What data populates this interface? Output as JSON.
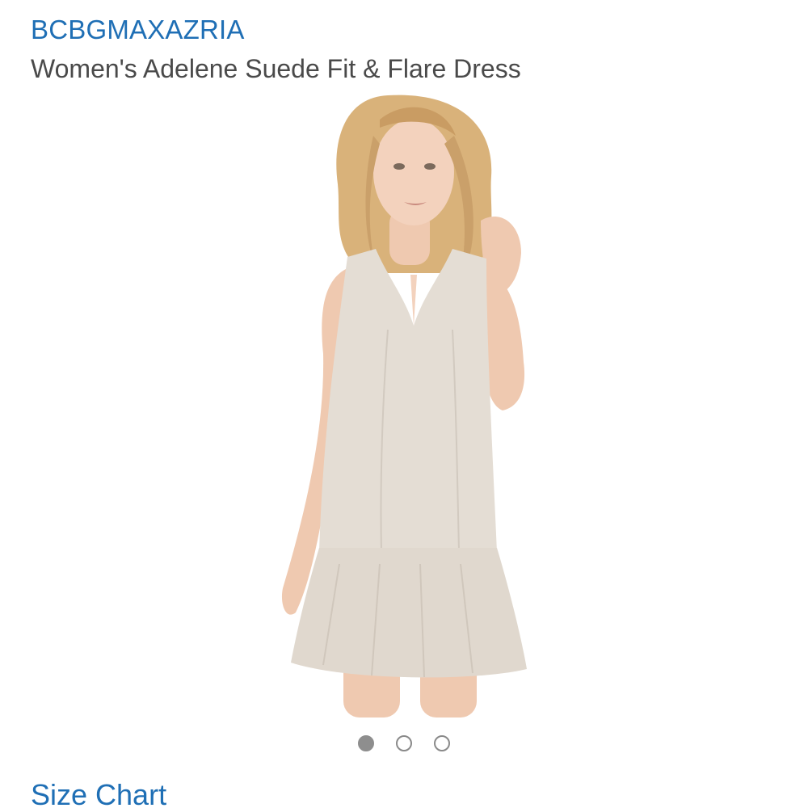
{
  "product": {
    "brand": "BCBGMAXAZRIA",
    "title": "Women's Adelene Suede Fit & Flare Dress",
    "image_alt": "Model wearing light beige sleeveless suede fit and flare dress"
  },
  "carousel": {
    "total": 3,
    "active_index": 0
  },
  "links": {
    "size_chart": "Size Chart"
  },
  "colors": {
    "link": "#1f6fb5",
    "title_text": "#4a4a4a",
    "dot_active": "#8e8e8e",
    "dot_inactive_border": "#8a8a8a"
  }
}
